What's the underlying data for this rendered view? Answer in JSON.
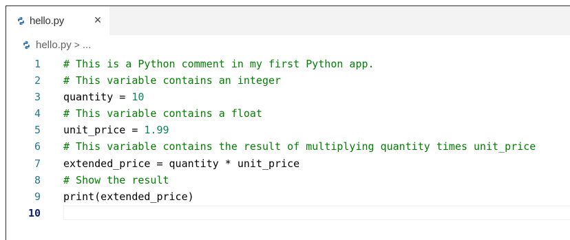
{
  "tab": {
    "icon": "python-file-icon",
    "label": "hello.py",
    "close_glyph": "×"
  },
  "breadcrumb": {
    "icon": "python-file-icon",
    "file": "hello.py",
    "separator": ">",
    "ellipsis": "..."
  },
  "editor": {
    "current_line": 10,
    "lines": [
      {
        "number": "1",
        "tokens": [
          {
            "type": "comment",
            "text": "# This is a Python comment in my first Python app."
          }
        ]
      },
      {
        "number": "2",
        "tokens": [
          {
            "type": "comment",
            "text": "# This variable contains an integer"
          }
        ]
      },
      {
        "number": "3",
        "tokens": [
          {
            "type": "plain",
            "text": "quantity = "
          },
          {
            "type": "number",
            "text": "10"
          }
        ]
      },
      {
        "number": "4",
        "tokens": [
          {
            "type": "comment",
            "text": "# This variable contains a float"
          }
        ]
      },
      {
        "number": "5",
        "tokens": [
          {
            "type": "plain",
            "text": "unit_price = "
          },
          {
            "type": "number",
            "text": "1.99"
          }
        ]
      },
      {
        "number": "6",
        "tokens": [
          {
            "type": "comment",
            "text": "# This variable contains the result of multiplying quantity times unit_price"
          }
        ]
      },
      {
        "number": "7",
        "tokens": [
          {
            "type": "plain",
            "text": "extended_price = quantity * unit_price"
          }
        ]
      },
      {
        "number": "8",
        "tokens": [
          {
            "type": "comment",
            "text": "# Show the result"
          }
        ]
      },
      {
        "number": "9",
        "tokens": [
          {
            "type": "plain",
            "text": "print(extended_price)"
          }
        ]
      },
      {
        "number": "10",
        "tokens": []
      }
    ]
  },
  "colors": {
    "comment": "#008000",
    "number": "#098658",
    "line_number": "#237893",
    "line_number_active": "#0b216f",
    "python_blue": "#3572a5",
    "python_yellow": "#f0c20b"
  }
}
